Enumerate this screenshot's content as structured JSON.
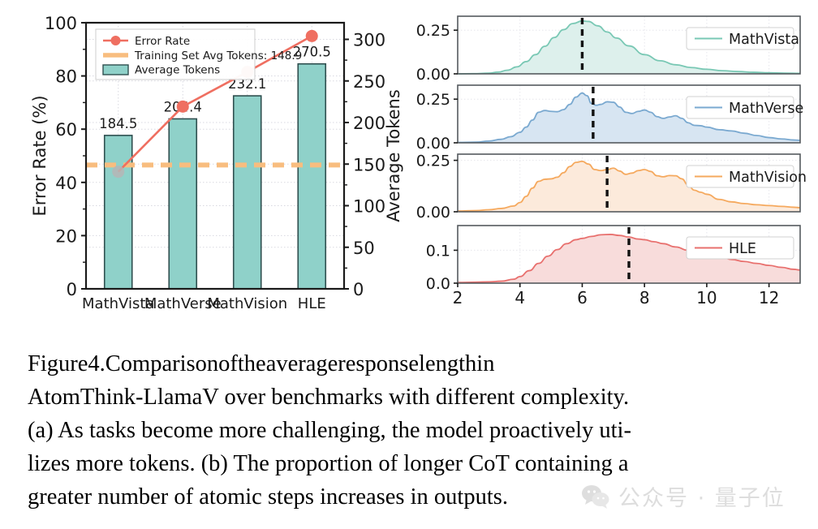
{
  "figure": {
    "label": "Figure 4.",
    "caption_lines": [
      "Figure 4.    Comparison of the average response length in",
      "AtomThink-LlamaV over benchmarks with different complexity.",
      "(a) As tasks become more challenging, the model proactively uti-",
      "lizes more tokens. (b) The proportion of longer CoT containing a",
      "greater number of atomic steps increases in outputs."
    ]
  },
  "watermark": {
    "text": "公众号 · 量子位",
    "icon": "wechat-icon"
  },
  "colors": {
    "error_rate": "#ef6f61",
    "threshold": "#f8bd7f",
    "bar_fill": "#8fd1c9",
    "bar_edge": "#2f4f4f",
    "mathvista": "#79c8b4",
    "mathverse": "#7aa9d0",
    "mathvision": "#f5a95e",
    "hle": "#e8706e",
    "dashed_marker": "#111111",
    "grid": "#d8d8e0"
  },
  "chart_data": [
    {
      "type": "bar",
      "id": "panel-a",
      "title": "",
      "xlabel": "",
      "ylabel": "Error Rate (%)",
      "y2label": "Average Tokens",
      "grid": true,
      "categories": [
        "MathVista",
        "MathVerse",
        "MathVision",
        "HLE"
      ],
      "ylim": [
        0,
        100
      ],
      "yticks": [
        0,
        20,
        40,
        60,
        80,
        100
      ],
      "y2lim": [
        0,
        320
      ],
      "y2ticks": [
        0,
        50,
        100,
        150,
        200,
        250,
        300
      ],
      "series": [
        {
          "name": "Average Tokens",
          "kind": "bar",
          "axis": "right",
          "values": [
            184.5,
            204.4,
            232.1,
            270.5
          ],
          "labels": [
            "184.5",
            "204.4",
            "232.1",
            "270.5"
          ]
        },
        {
          "name": "Error Rate",
          "kind": "line",
          "axis": "left",
          "values": [
            44.0,
            68.5,
            81.5,
            95.0
          ]
        },
        {
          "name": "Training Set Avg Tokens: 148.9",
          "kind": "hline",
          "axis": "right",
          "value": 148.9
        }
      ],
      "legend": {
        "position": "upper left",
        "entries": [
          {
            "label": "Error Rate",
            "marker": "line-marker"
          },
          {
            "label": "Training Set Avg Tokens: 148.9",
            "marker": "dashed-line"
          },
          {
            "label": "Average Tokens",
            "marker": "filled-rect"
          }
        ]
      }
    },
    {
      "type": "area",
      "id": "panel-b",
      "title": "",
      "xlabel": "",
      "grid": true,
      "xlim": [
        2,
        13
      ],
      "xticks": [
        2,
        4,
        6,
        8,
        10,
        12
      ],
      "subplots": [
        {
          "name": "MathVista",
          "ylim": [
            0,
            0.33
          ],
          "yticks": [
            0.0,
            0.25
          ],
          "ytick_labels": [
            "0.00",
            "0.25"
          ],
          "mean_line": 6.0,
          "x": [
            2.0,
            2.5,
            3.0,
            3.3,
            3.6,
            3.9,
            4.2,
            4.5,
            4.8,
            5.1,
            5.4,
            5.7,
            6.0,
            6.2,
            6.5,
            6.8,
            7.1,
            7.5,
            8.0,
            8.5,
            9.0,
            9.5,
            10.0,
            10.5,
            11.0,
            11.5,
            12.0,
            12.5,
            13.0
          ],
          "y": [
            0.0,
            0.001,
            0.004,
            0.01,
            0.021,
            0.04,
            0.07,
            0.11,
            0.158,
            0.208,
            0.253,
            0.288,
            0.303,
            0.3,
            0.275,
            0.24,
            0.205,
            0.16,
            0.11,
            0.075,
            0.052,
            0.036,
            0.026,
            0.018,
            0.013,
            0.009,
            0.006,
            0.004,
            0.003
          ]
        },
        {
          "name": "MathVerse",
          "ylim": [
            0,
            0.33
          ],
          "yticks": [
            0.0,
            0.25
          ],
          "ytick_labels": [
            "0.00",
            "0.25"
          ],
          "mean_line": 6.35,
          "x": [
            2.0,
            2.6,
            3.0,
            3.4,
            3.7,
            4.0,
            4.2,
            4.4,
            4.6,
            4.8,
            5.0,
            5.2,
            5.4,
            5.6,
            5.8,
            6.0,
            6.15,
            6.3,
            6.45,
            6.6,
            6.8,
            7.0,
            7.2,
            7.4,
            7.6,
            7.8,
            8.0,
            8.2,
            8.4,
            8.6,
            8.8,
            9.0,
            9.2,
            9.4,
            9.6,
            9.8,
            10.0,
            10.4,
            10.8,
            11.2,
            11.6,
            12.0,
            12.4,
            12.8,
            13.0
          ],
          "y": [
            0.002,
            0.004,
            0.01,
            0.02,
            0.035,
            0.06,
            0.09,
            0.13,
            0.175,
            0.185,
            0.18,
            0.178,
            0.19,
            0.22,
            0.262,
            0.285,
            0.27,
            0.225,
            0.215,
            0.22,
            0.235,
            0.232,
            0.205,
            0.175,
            0.168,
            0.18,
            0.188,
            0.175,
            0.15,
            0.14,
            0.148,
            0.155,
            0.14,
            0.115,
            0.1,
            0.098,
            0.09,
            0.075,
            0.068,
            0.055,
            0.042,
            0.03,
            0.022,
            0.016,
            0.014
          ]
        },
        {
          "name": "MathVision",
          "ylim": [
            0,
            0.28
          ],
          "yticks": [
            0.0,
            0.25
          ],
          "ytick_labels": [
            "0.00",
            "0.25"
          ],
          "mean_line": 6.8,
          "x": [
            2.0,
            2.6,
            3.0,
            3.4,
            3.8,
            4.0,
            4.2,
            4.4,
            4.6,
            4.8,
            5.0,
            5.2,
            5.4,
            5.6,
            5.8,
            6.0,
            6.2,
            6.4,
            6.6,
            6.8,
            7.0,
            7.2,
            7.4,
            7.6,
            7.8,
            8.0,
            8.2,
            8.4,
            8.6,
            8.8,
            9.0,
            9.2,
            9.4,
            9.6,
            9.8,
            10.0,
            10.4,
            10.8,
            11.2,
            11.6,
            12.0,
            12.4,
            12.8,
            13.0
          ],
          "y": [
            0.004,
            0.006,
            0.01,
            0.016,
            0.028,
            0.045,
            0.075,
            0.115,
            0.148,
            0.158,
            0.16,
            0.168,
            0.19,
            0.22,
            0.24,
            0.245,
            0.232,
            0.205,
            0.2,
            0.205,
            0.212,
            0.198,
            0.182,
            0.188,
            0.2,
            0.205,
            0.196,
            0.175,
            0.17,
            0.176,
            0.175,
            0.16,
            0.13,
            0.105,
            0.095,
            0.085,
            0.06,
            0.048,
            0.04,
            0.034,
            0.03,
            0.026,
            0.022,
            0.02
          ]
        },
        {
          "name": "HLE",
          "ylim": [
            0,
            0.175
          ],
          "yticks": [
            0.0,
            0.1
          ],
          "ytick_labels": [
            "0.0",
            "0.1"
          ],
          "mean_line": 7.5,
          "x": [
            2.0,
            2.6,
            3.0,
            3.4,
            3.8,
            4.0,
            4.3,
            4.6,
            4.9,
            5.2,
            5.5,
            5.8,
            6.0,
            6.3,
            6.6,
            6.9,
            7.2,
            7.5,
            7.8,
            8.0,
            8.3,
            8.6,
            9.0,
            9.4,
            9.8,
            10.2,
            10.5,
            10.8,
            11.2,
            11.6,
            12.0,
            12.4,
            12.8,
            13.0
          ],
          "y": [
            0.002,
            0.003,
            0.004,
            0.006,
            0.012,
            0.02,
            0.038,
            0.06,
            0.082,
            0.102,
            0.12,
            0.132,
            0.136,
            0.142,
            0.147,
            0.148,
            0.145,
            0.14,
            0.134,
            0.132,
            0.126,
            0.12,
            0.11,
            0.1,
            0.096,
            0.085,
            0.078,
            0.072,
            0.066,
            0.06,
            0.054,
            0.048,
            0.042,
            0.04
          ]
        }
      ]
    }
  ]
}
